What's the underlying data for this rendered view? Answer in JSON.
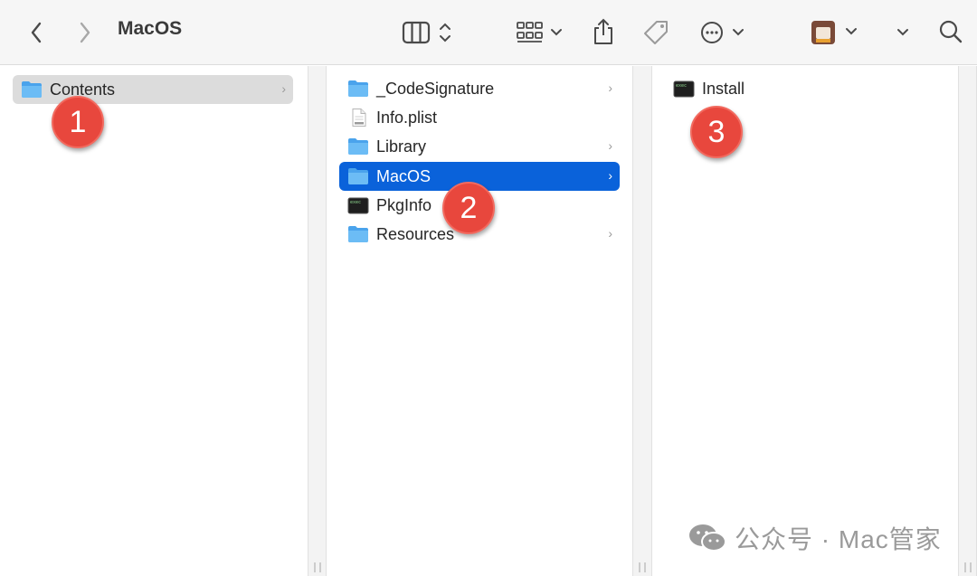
{
  "toolbar": {
    "title": "MacOS",
    "icons": [
      "back-icon",
      "forward-icon",
      "column-view-icon",
      "group-icon",
      "share-icon",
      "tag-icon",
      "more-icon",
      "profile-icon",
      "chevron-down-icon",
      "search-icon"
    ]
  },
  "columns": [
    {
      "items": [
        {
          "label": "Contents",
          "icon": "folder-icon",
          "has_children": true,
          "selected": "inactive"
        }
      ]
    },
    {
      "items": [
        {
          "label": "_CodeSignature",
          "icon": "folder-icon",
          "has_children": true
        },
        {
          "label": "Info.plist",
          "icon": "plist-file-icon",
          "has_children": false
        },
        {
          "label": "Library",
          "icon": "folder-icon",
          "has_children": true
        },
        {
          "label": "MacOS",
          "icon": "folder-icon",
          "has_children": true,
          "selected": "active"
        },
        {
          "label": "PkgInfo",
          "icon": "terminal-exec-icon",
          "has_children": false
        },
        {
          "label": "Resources",
          "icon": "folder-icon",
          "has_children": true
        }
      ]
    },
    {
      "items": [
        {
          "label": "Install",
          "icon": "terminal-exec-icon",
          "has_children": false
        }
      ]
    }
  ],
  "badges": [
    "1",
    "2",
    "3"
  ],
  "watermark": {
    "text": "公众号 · Mac管家",
    "icon": "wechat-icon"
  },
  "colors": {
    "selection_blue": "#0a62da",
    "badge_red": "#e8473d",
    "folder_blue": "#5ab0f0"
  }
}
